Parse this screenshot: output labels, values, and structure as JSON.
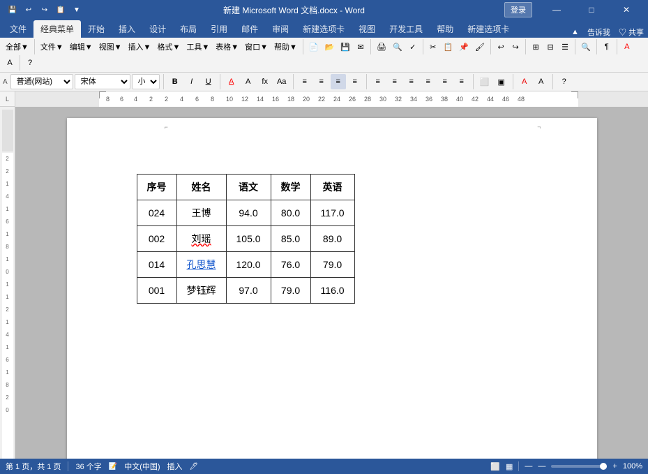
{
  "titleBar": {
    "title": "新建 Microsoft Word 文档.docx - Word",
    "loginLabel": "登录",
    "quickAccess": [
      "💾",
      "↩",
      "↪",
      "📋",
      "▼"
    ],
    "windowBtns": [
      "—",
      "□",
      "✕"
    ]
  },
  "tabs": {
    "items": [
      "文件",
      "经典菜单",
      "开始",
      "插入",
      "设计",
      "布局",
      "引用",
      "邮件",
      "审阅",
      "新建选项卡",
      "视图",
      "开发工具",
      "帮助",
      "新建选项卡"
    ],
    "activeIndex": 1,
    "rightItems": [
      "▲",
      "告诉我",
      "♡ 共享"
    ]
  },
  "toolbar1": {
    "groups": [
      {
        "label": "全部▼"
      },
      {
        "label": "文件▼"
      },
      {
        "label": "编辑▼"
      },
      {
        "label": "视图▼"
      },
      {
        "label": "插入▼"
      },
      {
        "label": "格式▼"
      },
      {
        "label": "工具▼"
      },
      {
        "label": "表格▼"
      },
      {
        "label": "窗口▼"
      },
      {
        "label": "帮助▼"
      }
    ],
    "icons": [
      "📄",
      "📁",
      "💾",
      "✂",
      "📋",
      "⎘",
      "↩",
      "↪",
      "🔍",
      "⚙",
      "📊",
      "⬜",
      "📝",
      "🔤",
      "🔠",
      "Aa",
      "≡",
      "≡",
      "≡",
      "≡",
      "≡",
      "≡",
      "⁋",
      "≡",
      "≡",
      "⬜",
      "⬜",
      "A",
      "A",
      "?"
    ]
  },
  "toolbar2": {
    "style": "普通(网站)",
    "font": "宋体",
    "size": "小二",
    "buttons": [
      "B",
      "I",
      "U",
      "A",
      "A",
      "fx",
      "Aa",
      "≡",
      "≡",
      "≡",
      "≡",
      "≡",
      "≡",
      "≡",
      "≡",
      "≡",
      "≡",
      "≡",
      "A",
      "A",
      "?"
    ]
  },
  "table": {
    "headers": [
      "序号",
      "姓名",
      "语文",
      "数学",
      "英语"
    ],
    "rows": [
      {
        "id": "024",
        "name": "王博",
        "chinese": "94.0",
        "math": "80.0",
        "english": "117.0",
        "nameStyle": "normal"
      },
      {
        "id": "002",
        "name": "刘瑶",
        "chinese": "105.0",
        "math": "85.0",
        "english": "89.0",
        "nameStyle": "wavy"
      },
      {
        "id": "014",
        "name": "孔思慧",
        "chinese": "120.0",
        "math": "76.0",
        "english": "79.0",
        "nameStyle": "link"
      },
      {
        "id": "001",
        "name": "梦钰辉",
        "chinese": "97.0",
        "math": "79.0",
        "english": "116.0",
        "nameStyle": "normal"
      }
    ]
  },
  "statusBar": {
    "page": "第 1 页，共 1 页",
    "words": "36 个字",
    "lang": "中文(中国)",
    "mode": "插入",
    "zoom": "100%"
  }
}
